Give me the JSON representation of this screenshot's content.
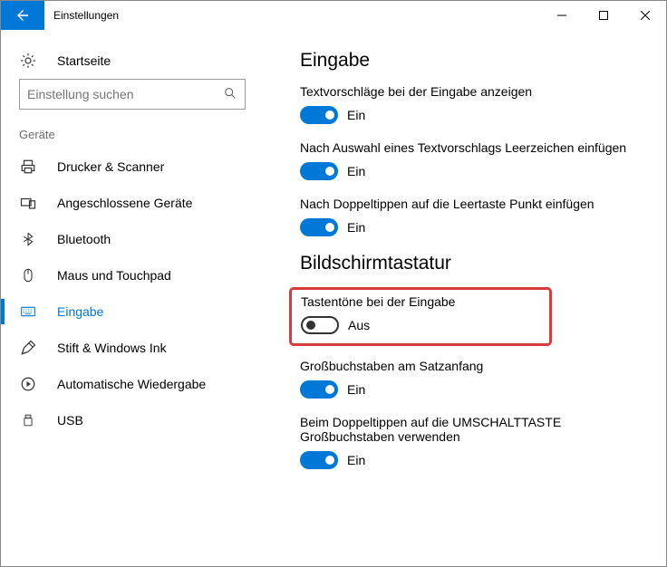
{
  "window": {
    "title": "Einstellungen"
  },
  "sidebar": {
    "home_label": "Startseite",
    "search_placeholder": "Einstellung suchen",
    "group_label": "Geräte",
    "items": [
      {
        "label": "Drucker & Scanner"
      },
      {
        "label": "Angeschlossene Geräte"
      },
      {
        "label": "Bluetooth"
      },
      {
        "label": "Maus und Touchpad"
      },
      {
        "label": "Eingabe"
      },
      {
        "label": "Stift & Windows Ink"
      },
      {
        "label": "Automatische Wiedergabe"
      },
      {
        "label": "USB"
      }
    ]
  },
  "content": {
    "section1_title": "Eingabe",
    "s1": {
      "label": "Textvorschläge bei der Eingabe anzeigen",
      "state": "Ein"
    },
    "s2": {
      "label": "Nach Auswahl eines Textvorschlags Leerzeichen einfügen",
      "state": "Ein"
    },
    "s3": {
      "label": "Nach Doppeltippen auf die Leertaste Punkt einfügen",
      "state": "Ein"
    },
    "section2_title": "Bildschirmtastatur",
    "s4": {
      "label": "Tastentöne bei der Eingabe",
      "state": "Aus"
    },
    "s5": {
      "label": "Großbuchstaben am Satzanfang",
      "state": "Ein"
    },
    "s6": {
      "label": "Beim Doppeltippen auf die UMSCHALTTASTE Großbuchstaben verwenden",
      "state": "Ein"
    }
  }
}
